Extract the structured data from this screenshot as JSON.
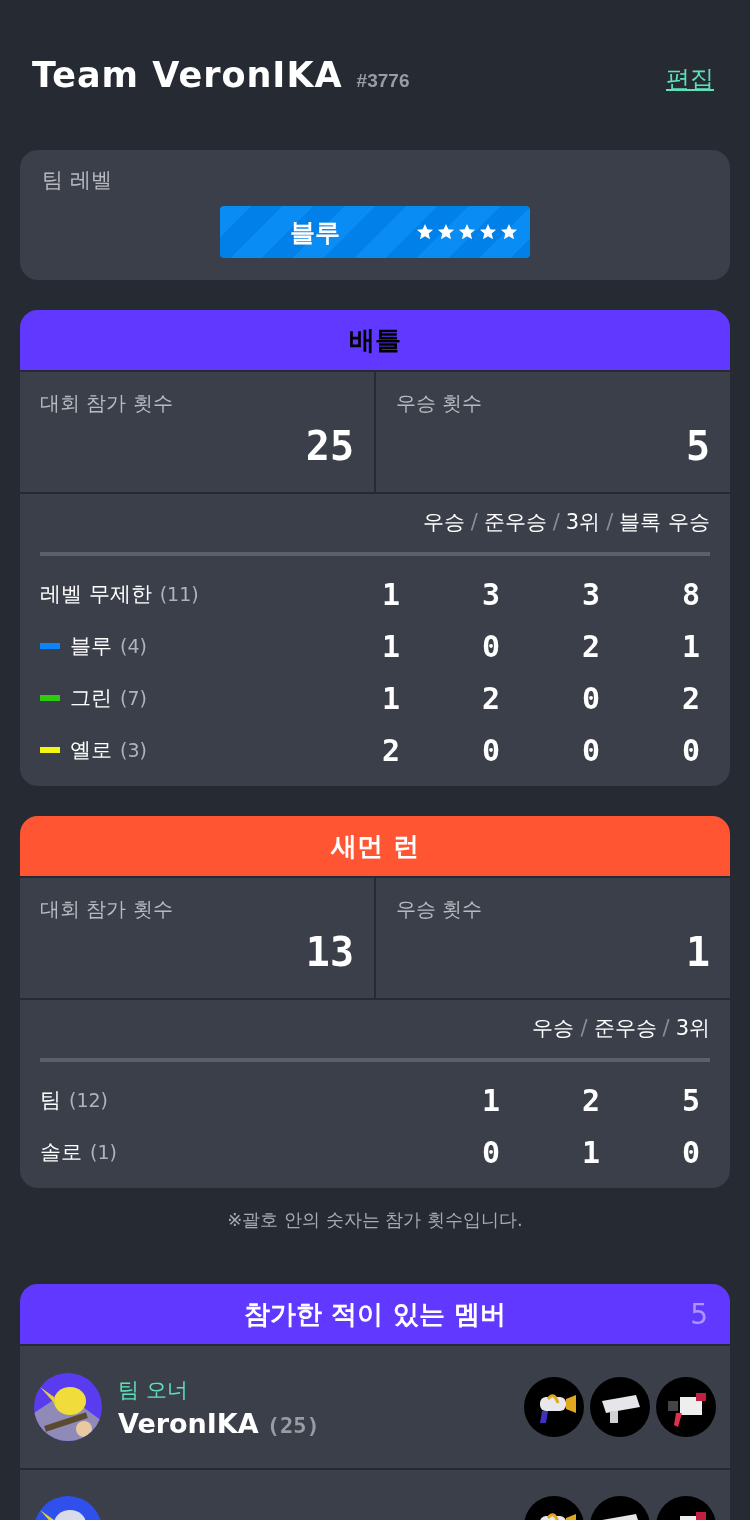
{
  "header": {
    "title": "Team VeronIKA",
    "tag": "#3776",
    "edit_link": "편집"
  },
  "team_level": {
    "label": "팀 레벨",
    "name": "블루",
    "stars": 5
  },
  "sections": [
    {
      "title": "배틀",
      "color": "#6038ff",
      "stats": [
        {
          "label": "대회 참가 횟수",
          "value": "25"
        },
        {
          "label": "우승 횟수",
          "value": "5"
        }
      ],
      "columns": [
        "우승",
        "준우승",
        "3위",
        "블록 우승"
      ],
      "separator": "/",
      "rows": [
        {
          "label": "레벨 무제한",
          "count": "(11)",
          "values": [
            "1",
            "3",
            "3",
            "8"
          ]
        },
        {
          "label": "블루",
          "count": "(4)",
          "color": "#0a84ff",
          "values": [
            "1",
            "0",
            "2",
            "1"
          ]
        },
        {
          "label": "그린",
          "count": "(7)",
          "color": "#2ecc11",
          "values": [
            "1",
            "2",
            "0",
            "2"
          ]
        },
        {
          "label": "옐로",
          "count": "(3)",
          "color": "#f5f514",
          "values": [
            "2",
            "0",
            "0",
            "0"
          ]
        }
      ]
    },
    {
      "title": "새먼 런",
      "color": "#ff5533",
      "stats": [
        {
          "label": "대회 참가 횟수",
          "value": "13"
        },
        {
          "label": "우승 횟수",
          "value": "1"
        }
      ],
      "columns": [
        "우승",
        "준우승",
        "3위"
      ],
      "separator": "/",
      "rows": [
        {
          "label": "팀",
          "count": "(12)",
          "values": [
            "1",
            "2",
            "5"
          ]
        },
        {
          "label": "솔로",
          "count": "(1)",
          "values": [
            "0",
            "1",
            "0"
          ]
        }
      ]
    }
  ],
  "note": "※괄호 안의 숫자는 참가 횟수입니다.",
  "members": {
    "title": "참가한 적이 있는 멤버",
    "count": "5",
    "items": [
      {
        "kind": "full",
        "role": "팀 오너",
        "name": "VeronIKA",
        "count": "(25)"
      },
      {
        "kind": "cut"
      }
    ]
  }
}
